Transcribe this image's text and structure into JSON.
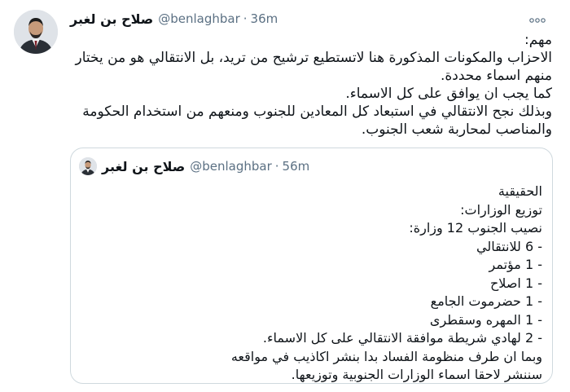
{
  "tweet": {
    "author_name": "صلاح بن لغبر",
    "handle": "@benlaghbar",
    "separator": "·",
    "time": "36m",
    "more_icon": "more-horizontal-icon",
    "lines": [
      "مهم:",
      "الاحزاب والمكونات المذكورة هنا لاتستطيع ترشيح من تريد، بل الانتقالي هو من يختار",
      "منهم اسماء محددة.",
      "كما يجب ان يوافق على كل الاسماء.",
      "وبذلك نجح الانتقالي في استبعاد كل المعادين للجنوب ومنعهم من استخدام الحكومة",
      "والمناصب لمحاربة شعب الجنوب."
    ]
  },
  "quoted_tweet": {
    "author_name": "صلاح بن لغبر",
    "handle": "@benlaghbar",
    "separator": "·",
    "time": "56m",
    "lines": [
      "الحقيقية",
      "توزيع الوزارات:",
      "نصيب الجنوب 12 وزارة:",
      "- 6 للانتقالي",
      "- 1 مؤتمر",
      "- 1 اصلاح",
      "- 1 حضرموت الجامع",
      "- 1 المهره وسقطرى",
      "- 2 لهادي شريطة موافقة الانتقالي على كل الاسماء.",
      "وبما ان طرف منظومة الفساد بدا بنشر اكاذيب في مواقعه",
      "سننشر لاحقا اسماء الوزارات الجنوبية وتوزيعها."
    ]
  },
  "colors": {
    "text": "#0f1419",
    "secondary": "#5b7083",
    "border": "#cfd9de"
  }
}
